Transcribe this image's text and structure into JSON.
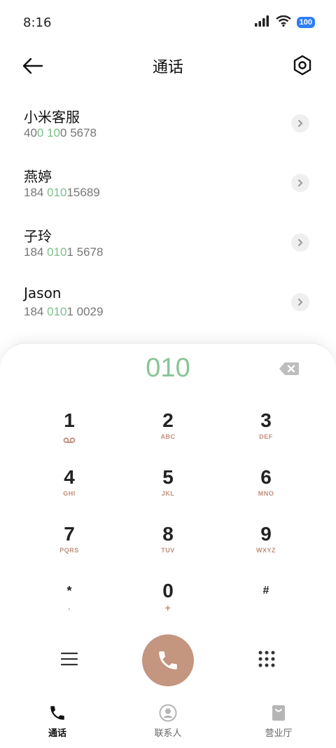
{
  "status": {
    "time": "8:16",
    "battery": "100"
  },
  "header": {
    "title": "通话"
  },
  "contacts": [
    {
      "name": "小米客服",
      "number_pre": "40",
      "number_hl": "0 10",
      "number_post": "0 5678"
    },
    {
      "name": "燕婷",
      "number_pre": "184 ",
      "number_hl": "010",
      "number_post": "15689"
    },
    {
      "name": "子玲",
      "number_pre": "184 ",
      "number_hl": "010",
      "number_post": "1 5678"
    },
    {
      "name": "Jason",
      "number_pre": "184 ",
      "number_hl": "010",
      "number_post": "1 0029"
    }
  ],
  "dialer": {
    "input": "010",
    "keys": [
      {
        "num": "1",
        "sub": "voicemail"
      },
      {
        "num": "2",
        "sub": "ABC"
      },
      {
        "num": "3",
        "sub": "DEF"
      },
      {
        "num": "4",
        "sub": "GHI"
      },
      {
        "num": "5",
        "sub": "JKL"
      },
      {
        "num": "6",
        "sub": "MNO"
      },
      {
        "num": "7",
        "sub": "PQRS"
      },
      {
        "num": "8",
        "sub": "TUV"
      },
      {
        "num": "9",
        "sub": "WXYZ"
      },
      {
        "num": "*",
        "sub": ","
      },
      {
        "num": "0",
        "sub": "+"
      },
      {
        "num": "#",
        "sub": ""
      }
    ]
  },
  "tabs": [
    {
      "label": "通话",
      "icon": "phone-icon"
    },
    {
      "label": "联系人",
      "icon": "contacts-icon"
    },
    {
      "label": "营业厅",
      "icon": "shopping-bag-icon"
    }
  ],
  "colors": {
    "accent": "#87c596",
    "call_button": "#c4957f",
    "key_subtext": "#c0907a"
  }
}
